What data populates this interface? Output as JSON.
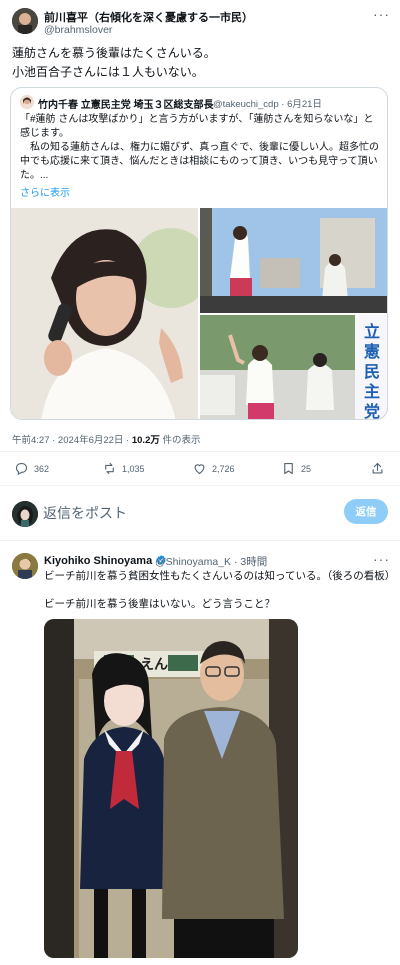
{
  "post": {
    "author_name": "前川喜平（右傾化を深く憂慮する一市民）",
    "author_handle": "@brahmslover",
    "text_line1": "蓮舫さんを慕う後輩はたくさんいる。",
    "text_line2": "小池百合子さんには１人もいない。",
    "more_label": "···"
  },
  "quote": {
    "author_name": "竹内千春 立憲民主党 埼玉３区総支部長",
    "author_handle": "@takeuchi_cdp · 6月21日",
    "text": "「#蓮舫 さんは攻撃ばかり」と言う方がいますが、「蓮舫さんを知らないな」と感じます。\n　私の知る蓮舫さんは、権力に媚びず、真っ直ぐで、後輩に優しい人。超多忙の中でも応援に来て頂き、悩んだときは相談にものって頂き、いつも見守って頂いた。...",
    "show_more": "さらに表示",
    "banner_text": "立憲民主党"
  },
  "meta": {
    "time": "午前4:27 · 2024年6月22日 · ",
    "views": "10.2万",
    "views_suffix": " 件の表示"
  },
  "actions": {
    "replies": "362",
    "reposts": "1,035",
    "likes": "2,726",
    "bookmarks": "25"
  },
  "reply_box": {
    "placeholder": "返信をポスト",
    "button": "返信"
  },
  "reply_post": {
    "author_name": "Kiyohiko Shinoyama",
    "author_handle": "@Shinoyama_K · 3時間",
    "text_line1": "ビーチ前川を慕う貧困女性もたくさんいるのは知っている。（後ろの看板）",
    "text_line2": "ビーチ前川を慕う後輩はいない。どう言うこと？",
    "sign_text": "えん",
    "more_label": "···"
  },
  "colors": {
    "accent": "#1d9bf0",
    "muted": "#536471",
    "border": "#cfd9de"
  }
}
